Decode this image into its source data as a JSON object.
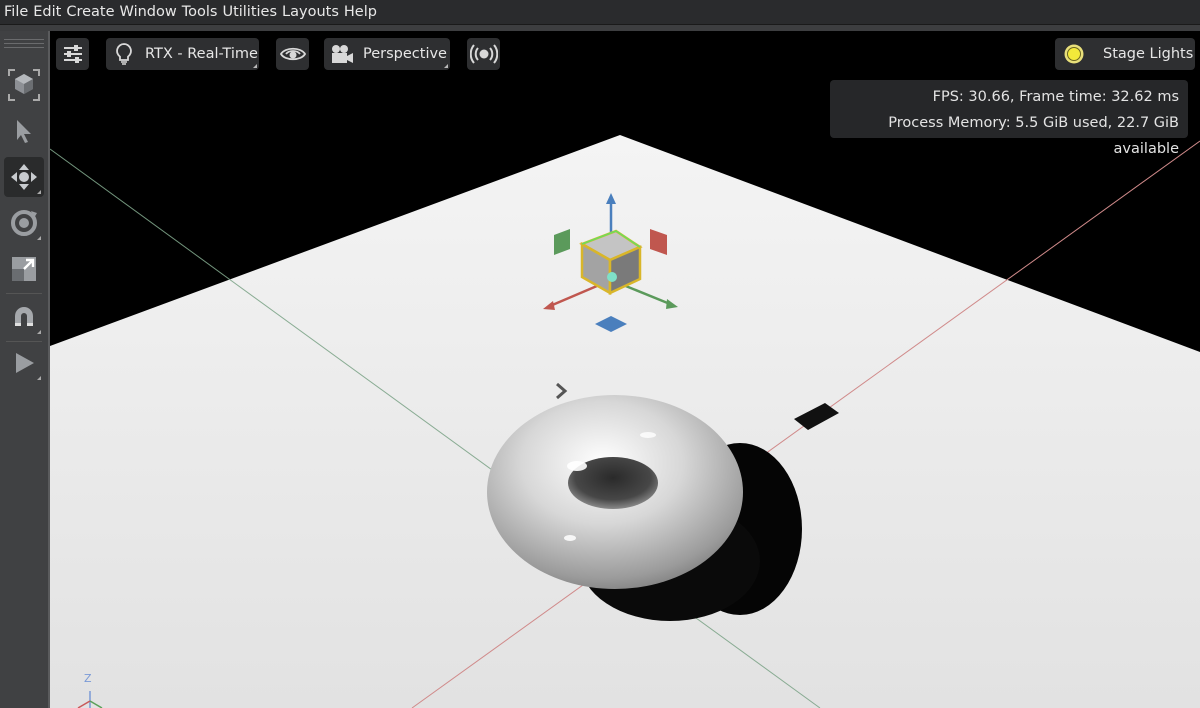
{
  "menu": [
    "File",
    "Edit",
    "Create",
    "Window",
    "Tools",
    "Utilities",
    "Layouts",
    "Help"
  ],
  "toolbar": {
    "tools": [
      {
        "name": "select-mode-icon"
      },
      {
        "name": "select-arrow-icon"
      },
      {
        "name": "move-icon",
        "active": true
      },
      {
        "name": "rotate-icon"
      },
      {
        "name": "scale-icon"
      },
      {
        "name": "snap-magnet-icon"
      },
      {
        "name": "play-icon"
      }
    ]
  },
  "viewport_toolbar": {
    "render_mode": "RTX - Real-Time",
    "camera": "Perspective",
    "lighting": "Stage Lights"
  },
  "stats": {
    "fps_line": "FPS: 30.66, Frame time: 32.62 ms",
    "memory_line": "Process Memory: 5.5 GiB used, 22.7 GiB available"
  },
  "axis_indicator": {
    "up_label": "Z"
  }
}
